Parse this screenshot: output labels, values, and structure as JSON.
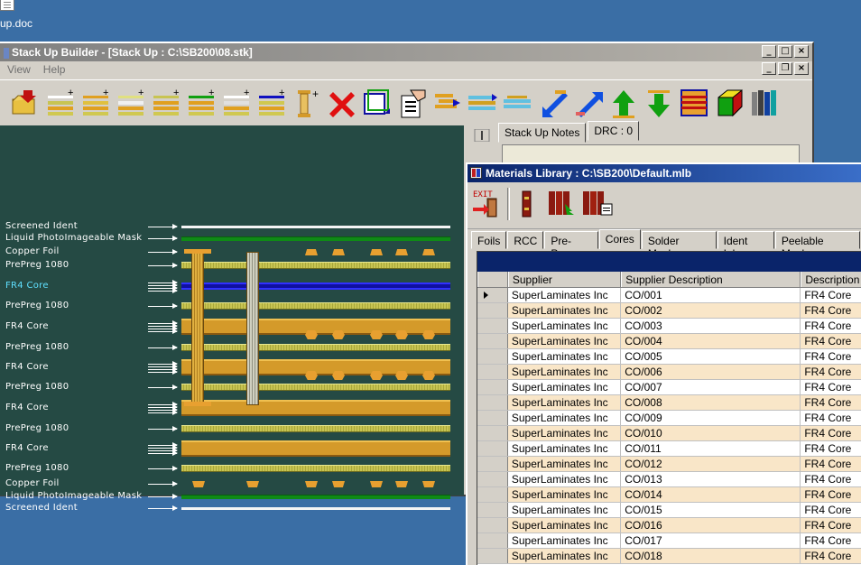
{
  "desktop": {
    "icon_label": "up.doc"
  },
  "main_window": {
    "title": "Stack Up Builder - [Stack Up : C:\\SB200\\08.stk]",
    "menu": [
      "View",
      "Help"
    ],
    "toolbar": [
      "open-icon",
      "add-screen-ident-icon",
      "add-mask-icon",
      "add-copper-icon",
      "add-preg-icon",
      "add-core-icon",
      "add-foil-icon",
      "add-layer-icon",
      "add-via-icon",
      "delete-icon",
      "copy-icon",
      "properties-icon",
      "move-icon",
      "stretch-icon",
      "shrink-icon",
      "arrow-down-left-icon",
      "arrow-up-right-icon",
      "arrow-up-icon",
      "arrow-down-icon",
      "layers-icon",
      "cube-icon",
      "library-icon"
    ],
    "layers": [
      {
        "label": "Screened Ident",
        "type": "white"
      },
      {
        "label": "Liquid PhotoImageable Mask",
        "type": "green"
      },
      {
        "label": "Copper Foil",
        "type": "foil"
      },
      {
        "label": "PrePreg 1080",
        "type": "preg"
      },
      {
        "label": "FR4 Core",
        "type": "core-selected"
      },
      {
        "label": "PrePreg 1080",
        "type": "preg"
      },
      {
        "label": "FR4 Core",
        "type": "core"
      },
      {
        "label": "PrePreg 1080",
        "type": "preg"
      },
      {
        "label": "FR4 Core",
        "type": "core"
      },
      {
        "label": "PrePreg 1080",
        "type": "preg"
      },
      {
        "label": "FR4 Core",
        "type": "core"
      },
      {
        "label": "PrePreg 1080",
        "type": "preg"
      },
      {
        "label": "FR4 Core",
        "type": "core"
      },
      {
        "label": "PrePreg 1080",
        "type": "preg"
      },
      {
        "label": "Copper Foil",
        "type": "foil"
      },
      {
        "label": "Liquid PhotoImageable Mask",
        "type": "green"
      },
      {
        "label": "Screened Ident",
        "type": "white"
      }
    ],
    "notes_tabs": [
      "Stack Up Notes",
      "DRC : 0"
    ]
  },
  "materials_library": {
    "title": "Materials Library : C:\\SB200\\Default.mlb",
    "tools": [
      "exit-icon",
      "single-book-icon",
      "books-arrow-icon",
      "books-print-icon"
    ],
    "exit_label": "EXIT",
    "tabs": [
      "Foils",
      "RCC",
      "Pre-Preg",
      "Cores",
      "Solder Masks",
      "Ident Inks",
      "Peelable Masks"
    ],
    "active_tab": "Cores",
    "columns": [
      "Supplier",
      "Supplier Description",
      "Description"
    ],
    "rows": [
      [
        "SuperLaminates Inc",
        "CO/001",
        "FR4 Core"
      ],
      [
        "SuperLaminates Inc",
        "CO/002",
        "FR4 Core"
      ],
      [
        "SuperLaminates Inc",
        "CO/003",
        "FR4 Core"
      ],
      [
        "SuperLaminates Inc",
        "CO/004",
        "FR4 Core"
      ],
      [
        "SuperLaminates Inc",
        "CO/005",
        "FR4 Core"
      ],
      [
        "SuperLaminates Inc",
        "CO/006",
        "FR4 Core"
      ],
      [
        "SuperLaminates Inc",
        "CO/007",
        "FR4 Core"
      ],
      [
        "SuperLaminates Inc",
        "CO/008",
        "FR4 Core"
      ],
      [
        "SuperLaminates Inc",
        "CO/009",
        "FR4 Core"
      ],
      [
        "SuperLaminates Inc",
        "CO/010",
        "FR4 Core"
      ],
      [
        "SuperLaminates Inc",
        "CO/011",
        "FR4 Core"
      ],
      [
        "SuperLaminates Inc",
        "CO/012",
        "FR4 Core"
      ],
      [
        "SuperLaminates Inc",
        "CO/013",
        "FR4 Core"
      ],
      [
        "SuperLaminates Inc",
        "CO/014",
        "FR4 Core"
      ],
      [
        "SuperLaminates Inc",
        "CO/015",
        "FR4 Core"
      ],
      [
        "SuperLaminates Inc",
        "CO/016",
        "FR4 Core"
      ],
      [
        "SuperLaminates Inc",
        "CO/017",
        "FR4 Core"
      ],
      [
        "SuperLaminates Inc",
        "CO/018",
        "FR4 Core"
      ]
    ]
  },
  "colors": {
    "desktop": "#3a6ea5",
    "stack_bg": "#254a44",
    "row_alt": "#f9e6c8",
    "title_active": "#0a246a"
  }
}
